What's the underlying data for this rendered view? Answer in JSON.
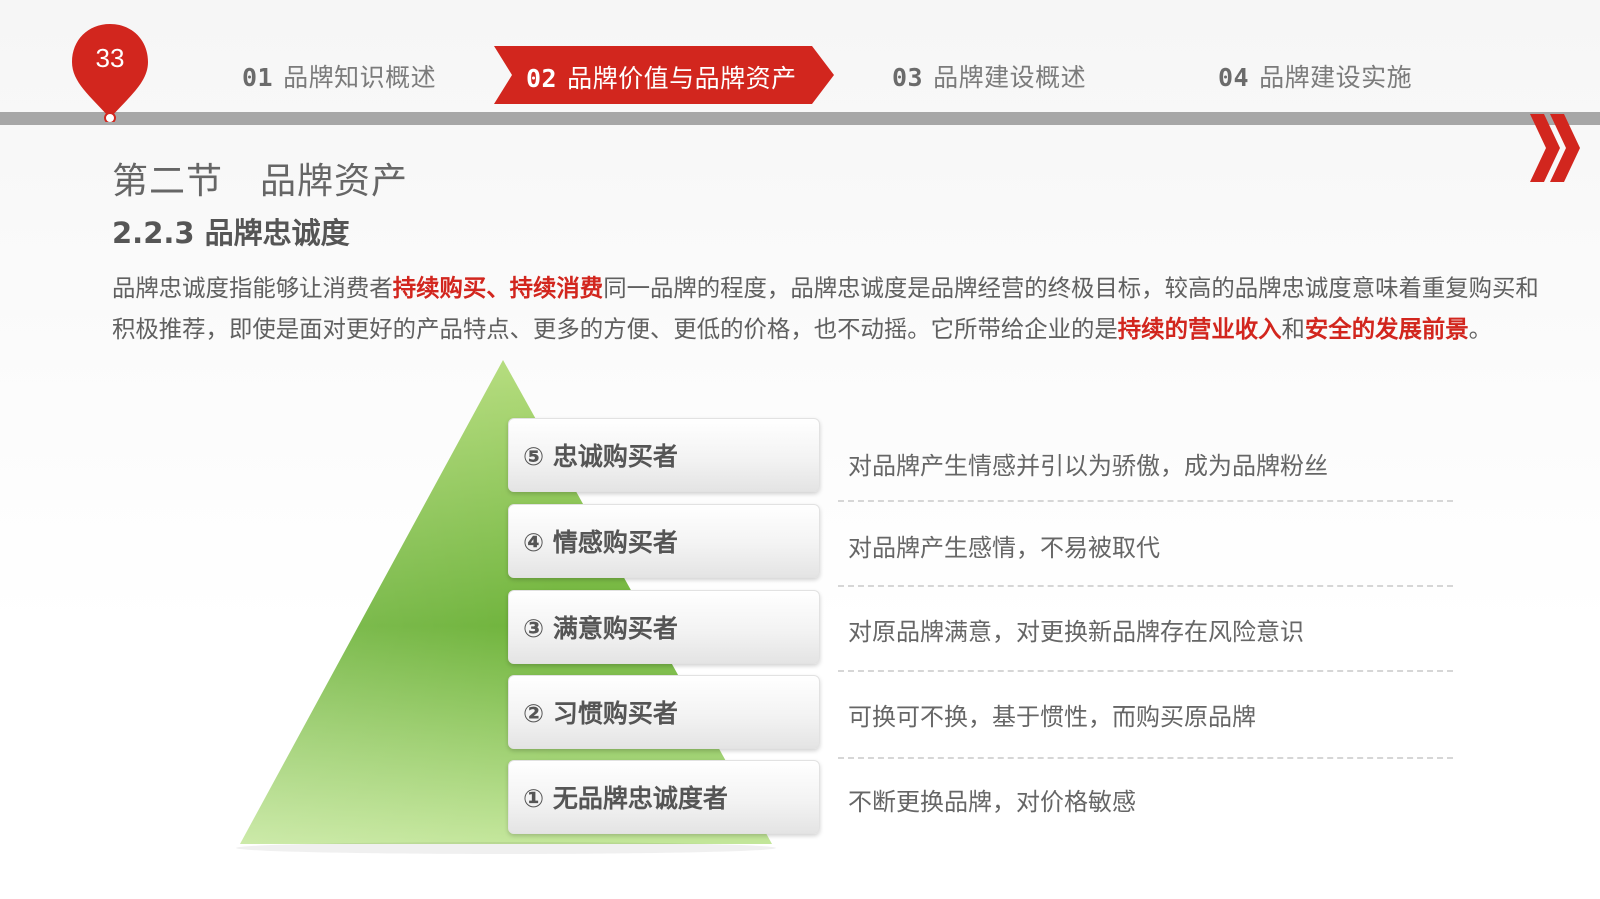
{
  "page": {
    "number": "33"
  },
  "nav": {
    "tabs": [
      {
        "num": "01",
        "label": "品牌知识概述"
      },
      {
        "num": "02",
        "label": "品牌价值与品牌资产"
      },
      {
        "num": "03",
        "label": "品牌建设概述"
      },
      {
        "num": "04",
        "label": "品牌建设实施"
      }
    ],
    "active_index": 1
  },
  "content": {
    "section_title": "第二节　品牌资产",
    "subsection_title": "2.2.3 品牌忠诚度",
    "intro": {
      "p1": "品牌忠诚度指能够让消费者",
      "hl1": "持续购买、持续消费",
      "p2": "同一品牌的程度，品牌忠诚度是品牌经营的终极目标，较高的品牌忠诚度意味着重复购买和积极推荐，即使是面对更好的产品特点、更多的方便、更低的价格，也不动摇。它所带给企业的是",
      "hl2": "持续的营业收入",
      "p3": "和",
      "hl3": "安全的发展前景",
      "p4": "。"
    },
    "levels": [
      {
        "label": "⑤ 忠诚购买者",
        "desc": "对品牌产生情感并引以为骄傲，成为品牌粉丝"
      },
      {
        "label": "④ 情感购买者",
        "desc": "对品牌产生感情，不易被取代"
      },
      {
        "label": "③ 满意购买者",
        "desc": "对原品牌满意，对更换新品牌存在风险意识"
      },
      {
        "label": "② 习惯购买者",
        "desc": "可换可不换，基于惯性，而购买原品牌"
      },
      {
        "label": "① 无品牌忠诚度者",
        "desc": "不断更换品牌，对价格敏感"
      }
    ]
  },
  "colors": {
    "accent": "#d2261e",
    "pyramid_top": "#b4dc7c",
    "pyramid_mid": "#6eb33a",
    "pyramid_bottom": "#c3e69a",
    "nav_bar": "#a7a7a7"
  },
  "icons": {
    "page_badge": "map-pin-icon",
    "next": "double-chevron-right-icon"
  }
}
